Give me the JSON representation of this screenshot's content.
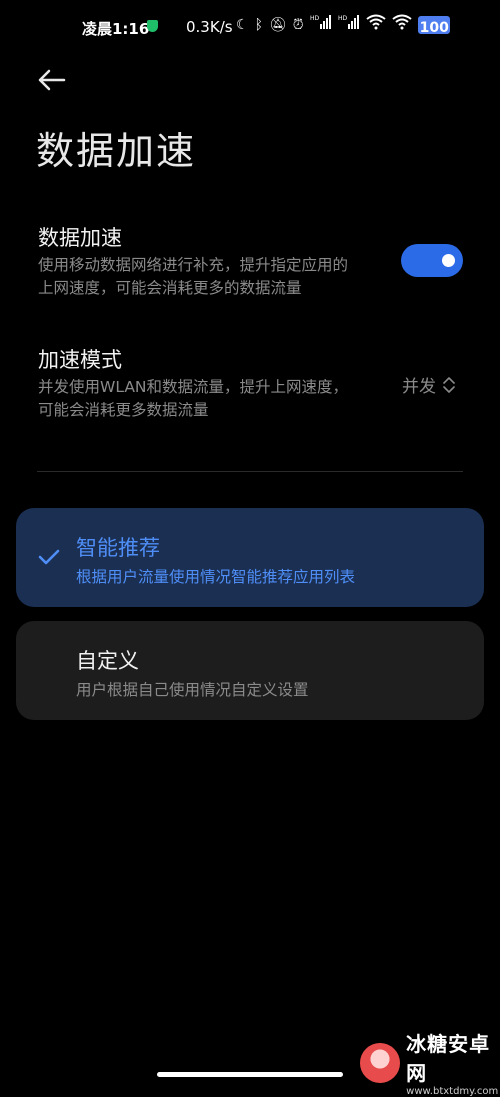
{
  "status_bar": {
    "time": "凌晨1:16",
    "net_speed": "0.3K/s",
    "battery": "100",
    "icons": [
      "moon-icon",
      "bluetooth-icon",
      "mute-icon",
      "alarm-icon",
      "signal-hd-icon",
      "signal-hd-icon",
      "wifi-icon",
      "wifi-icon",
      "battery-icon"
    ]
  },
  "header": {
    "title": "数据加速"
  },
  "settings": {
    "data_accel": {
      "title": "数据加速",
      "desc_line1": "使用移动数据网络进行补充，提升指定应用的",
      "desc_line2": "上网速度，可能会消耗更多的数据流量",
      "enabled": true
    },
    "accel_mode": {
      "title": "加速模式",
      "desc_line1": "并发使用WLAN和数据流量，提升上网速度，",
      "desc_line2": "可能会消耗更多数据流量",
      "value": "并发"
    }
  },
  "options": [
    {
      "title": "智能推荐",
      "desc": "根据用户流量使用情况智能推荐应用列表",
      "selected": true
    },
    {
      "title": "自定义",
      "desc": "用户根据自己使用情况自定义设置",
      "selected": false
    }
  ],
  "watermark": {
    "name": "冰糖安卓网",
    "url": "www.btxtdmy.com"
  },
  "colors": {
    "accent": "#2c6be8",
    "selected_text": "#4f8ef7",
    "selected_bg": "#1a2f52",
    "card_bg": "#1d1d1d"
  }
}
